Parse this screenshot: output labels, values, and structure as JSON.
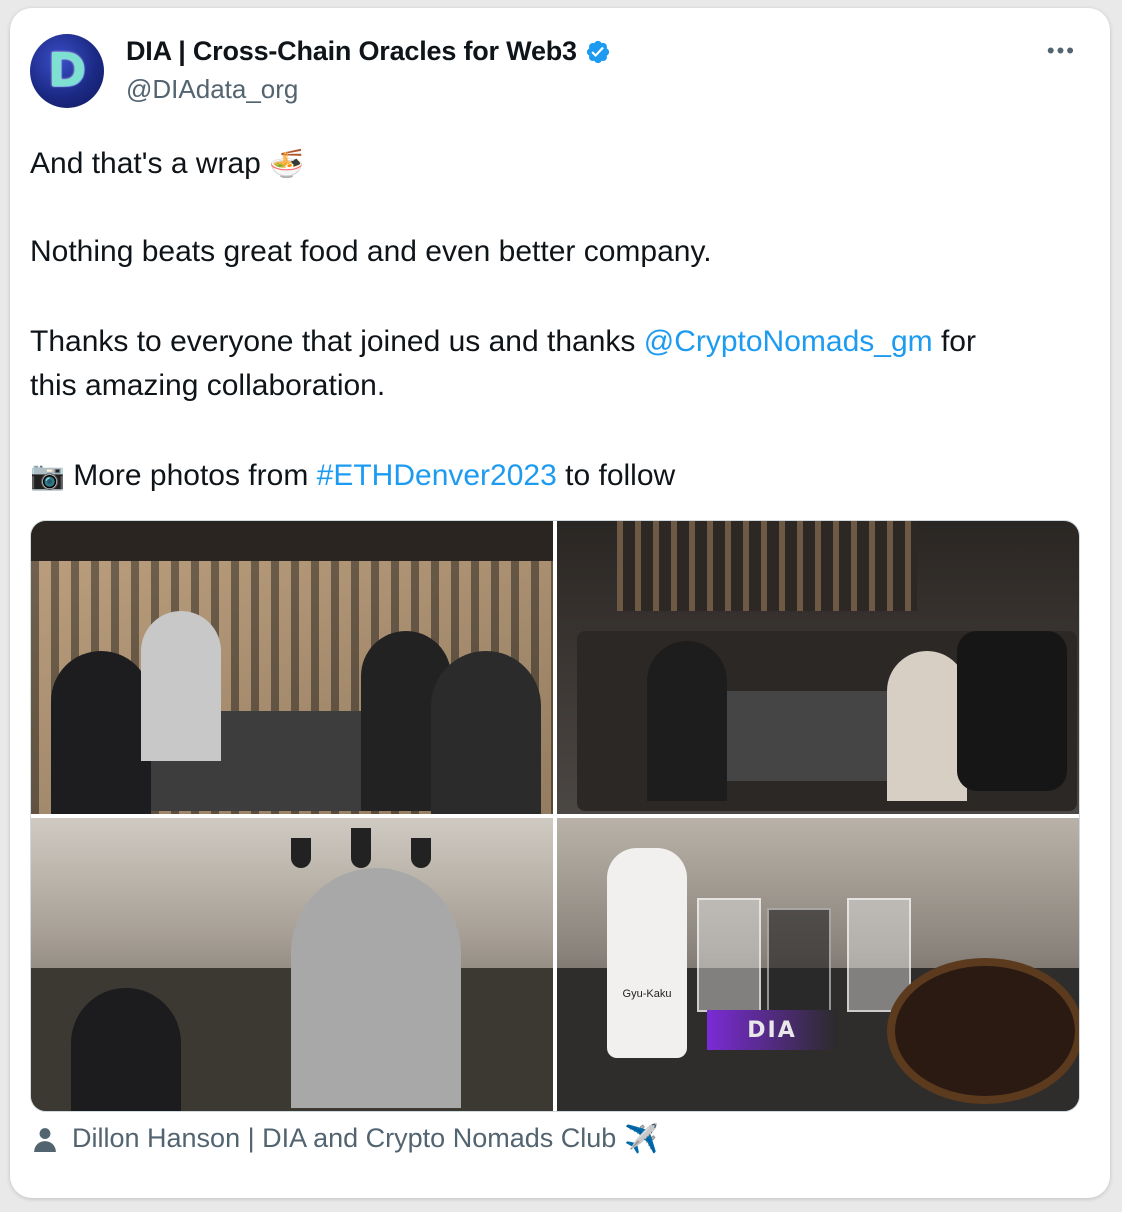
{
  "author": {
    "name": "DIA | Cross-Chain Oracles for Web3",
    "handle": "@DIAdata_org",
    "avatar_letter": "D",
    "verified": true
  },
  "menu": {
    "more_label": "•••"
  },
  "tweet": {
    "line1": "And that's a wrap",
    "line1_emoji": "🍜",
    "line2": "Nothing beats great food and even better company.",
    "line3_pre": "Thanks to everyone that joined us and thanks",
    "line3_mention": "@CryptoNomads_gm",
    "line3_post": "for",
    "line4": "this amazing collaboration.",
    "line5_emoji": "📷",
    "line5_pre": "More photos from",
    "line5_hashtag": "#ETHDenver2023",
    "line5_post": "to follow"
  },
  "photos": [
    {
      "name": "group-photo-1"
    },
    {
      "name": "group-photo-2"
    },
    {
      "name": "restaurant-photo"
    },
    {
      "name": "table-photo"
    }
  ],
  "photo_text": {
    "bottle_label": "Gyu-Kaku",
    "card_label": "DIA"
  },
  "caption": {
    "text": "Dillon Hanson | DIA and Crypto Nomads Club",
    "emoji": "✈️"
  },
  "colors": {
    "link": "#1d9bf0",
    "muted": "#536471",
    "text": "#0f1419"
  }
}
